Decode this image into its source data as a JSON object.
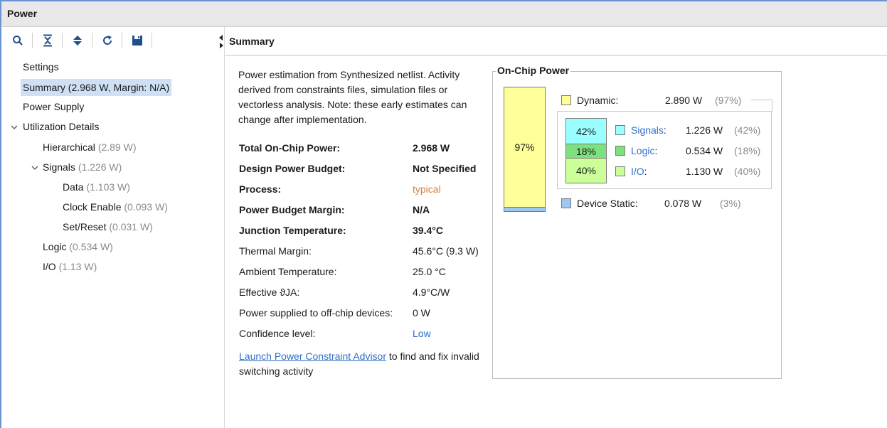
{
  "window": {
    "title": "Power"
  },
  "toolbar": {
    "icons": [
      "search-icon",
      "collapse-all-icon",
      "expand-all-icon",
      "refresh-icon",
      "save-icon"
    ]
  },
  "tree": {
    "settings": "Settings",
    "summary": "Summary (2.968 W, Margin: N/A)",
    "power_supply": "Power Supply",
    "utilization_details": "Utilization Details",
    "hierarchical": {
      "label": "Hierarchical",
      "value": "(2.89 W)"
    },
    "signals": {
      "label": "Signals",
      "value": "(1.226 W)"
    },
    "data": {
      "label": "Data",
      "value": "(1.103 W)"
    },
    "clock_enable": {
      "label": "Clock Enable",
      "value": "(0.093 W)"
    },
    "set_reset": {
      "label": "Set/Reset",
      "value": "(0.031 W)"
    },
    "logic": {
      "label": "Logic",
      "value": "(0.534 W)"
    },
    "io": {
      "label": "I/O",
      "value": "(1.13 W)"
    }
  },
  "summary": {
    "header": "Summary",
    "description": "Power estimation from Synthesized netlist. Activity derived from constraints files, simulation files or vectorless analysis. Note: these early estimates can change after implementation.",
    "properties": [
      {
        "key": "Total On-Chip Power:",
        "value": "2.968 W"
      },
      {
        "key": "Design Power Budget:",
        "value": "Not Specified"
      },
      {
        "key": "Process:",
        "value": "typical"
      },
      {
        "key": "Power Budget Margin:",
        "value": "N/A"
      },
      {
        "key": "Junction Temperature:",
        "value": "39.4°C"
      },
      {
        "key": "Thermal Margin:",
        "value": "45.6°C (9.3 W)"
      },
      {
        "key": "Ambient Temperature:",
        "value": "25.0 °C"
      },
      {
        "key": "Effective ϑJA:",
        "value": "4.9°C/W"
      },
      {
        "key": "Power supplied to off-chip devices:",
        "value": "0 W"
      },
      {
        "key": "Confidence level:",
        "value": "Low"
      }
    ],
    "advisor_link": "Launch Power Constraint Advisor",
    "advisor_text": " to find and fix invalid switching activity"
  },
  "on_chip_power": {
    "title": "On-Chip Power",
    "bar_dynamic_label": "97%",
    "dynamic_fraction": 0.97,
    "dynamic": {
      "label": "Dynamic:",
      "value": "2.890 W",
      "pct": "(97%)",
      "color": "#ffff99"
    },
    "signals": {
      "label": "Signals",
      "colon": ":",
      "value": "1.226 W",
      "pct": "(42%)",
      "bar": "42%",
      "color": "#99ffff"
    },
    "logic": {
      "label": "Logic",
      "colon": ":",
      "value": "0.534 W",
      "pct": "(18%)",
      "bar": "18%",
      "color": "#7fe07f"
    },
    "io": {
      "label": "I/O",
      "colon": ":",
      "value": "1.130 W",
      "pct": "(40%)",
      "bar": "40%",
      "color": "#ccff99"
    },
    "device_static": {
      "label": "Device Static:",
      "value": "0.078 W",
      "pct": "(3%)",
      "color": "#9cc8f2"
    }
  }
}
